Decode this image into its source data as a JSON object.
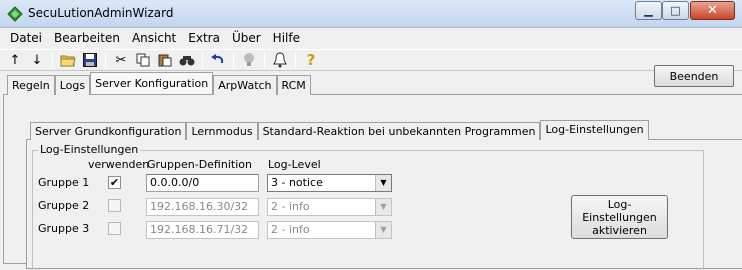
{
  "window": {
    "title": "SecuLutionAdminWizard",
    "min_symbol": "▁",
    "max_symbol": "□",
    "close_symbol": "✕"
  },
  "menu": [
    "Datei",
    "Bearbeiten",
    "Ansicht",
    "Extra",
    "Über",
    "Hilfe"
  ],
  "toolbar": {
    "icons": [
      "arrow-up-icon",
      "arrow-down-icon",
      "open-folder-icon",
      "save-icon",
      "cut-icon",
      "copy-icon",
      "paste-icon",
      "find-icon",
      "undo-icon",
      "lightbulb-icon",
      "bell-icon",
      "help-icon"
    ],
    "glyphs": [
      "↑",
      "↓",
      "📂",
      "💾",
      "✂",
      "⎘",
      "📋",
      "🔍",
      "↶",
      "💡",
      "🔔",
      "?"
    ]
  },
  "beenden_label": "Beenden",
  "main_tabs": [
    "Regeln",
    "Logs",
    "Server Konfiguration",
    "ArpWatch",
    "RCM"
  ],
  "active_main_tab": "Server Konfiguration",
  "sub_tabs": [
    "Server Grundkonfiguration",
    "Lernmodus",
    "Standard-Reaktion bei unbekannten Programmen",
    "Log-Einstellungen"
  ],
  "active_sub_tab": "Log-Einstellungen",
  "log_settings": {
    "group_title": "Log-Einstellungen",
    "col_use": "verwenden",
    "col_group_def": "Gruppen-Definition",
    "col_log_level": "Log-Level",
    "rows": [
      {
        "label": "Gruppe 1",
        "checked": true,
        "definition": "0.0.0.0/0",
        "level": "3 - notice",
        "enabled": true
      },
      {
        "label": "Gruppe 2",
        "checked": false,
        "definition": "192.168.16.30/32",
        "level": "2 - info",
        "enabled": false
      },
      {
        "label": "Gruppe 3",
        "checked": false,
        "definition": "192.168.16.71/32",
        "level": "2 - info",
        "enabled": false
      }
    ],
    "activate_label": "Log-Einstellungen aktivieren"
  },
  "colors": {
    "titlebar": "#c2d6ee",
    "close_button": "#c9442b",
    "window_bg": "#f0f0f0"
  }
}
